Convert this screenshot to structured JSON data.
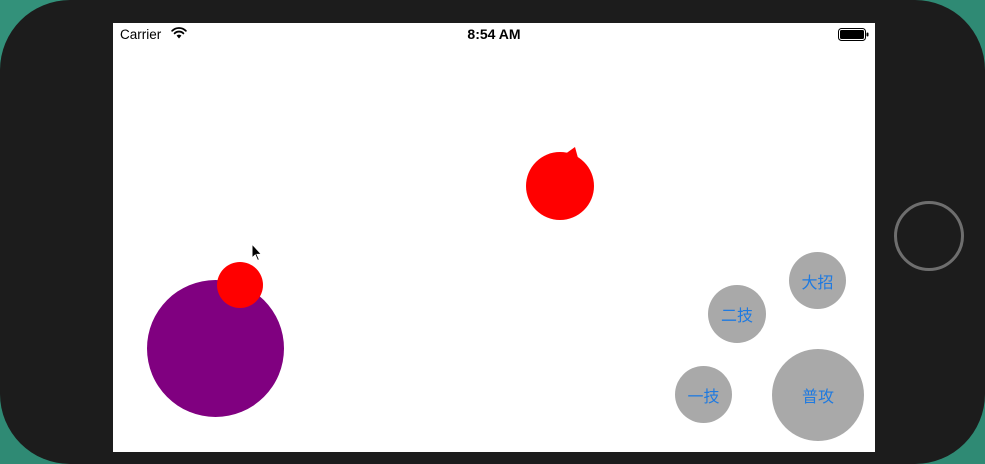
{
  "status_bar": {
    "carrier": "Carrier",
    "time": "8:54 AM"
  },
  "game": {
    "colors": {
      "joystick": "#800080",
      "player": "#ff0000",
      "enemy": "#ff0000",
      "button_bg": "#a9a9a9",
      "button_text": "#1f7ae0"
    }
  },
  "skills": {
    "ultimate": "大招",
    "skill_two": "二技",
    "skill_one": "一技",
    "basic_attack": "普攻"
  },
  "icons": {
    "wifi": "wifi-icon",
    "battery": "battery-icon",
    "cursor": "cursor-icon",
    "home": "home-button"
  }
}
